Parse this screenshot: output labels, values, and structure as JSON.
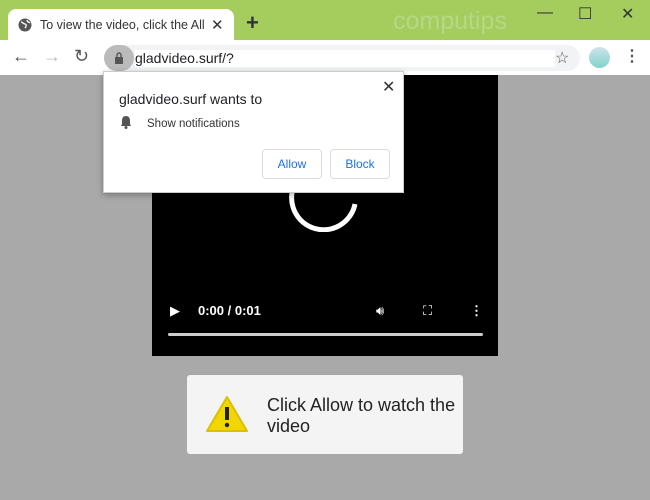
{
  "browser": {
    "tab_title": "To view the video, click the Allow",
    "watermark": "computips",
    "url": "gladvideo.surf/?"
  },
  "popup": {
    "heading": "gladvideo.surf wants to",
    "permission": "Show notifications",
    "allow_label": "Allow",
    "block_label": "Block"
  },
  "video": {
    "time": "0:00 / 0:01",
    "progress": 0
  },
  "message": {
    "text": "Click Allow to watch the video"
  },
  "colors": {
    "titlebar": "#a4cd5e",
    "page_bg": "#a9a9a9",
    "accent": "#1a73e8",
    "warning": "#f2d600"
  }
}
